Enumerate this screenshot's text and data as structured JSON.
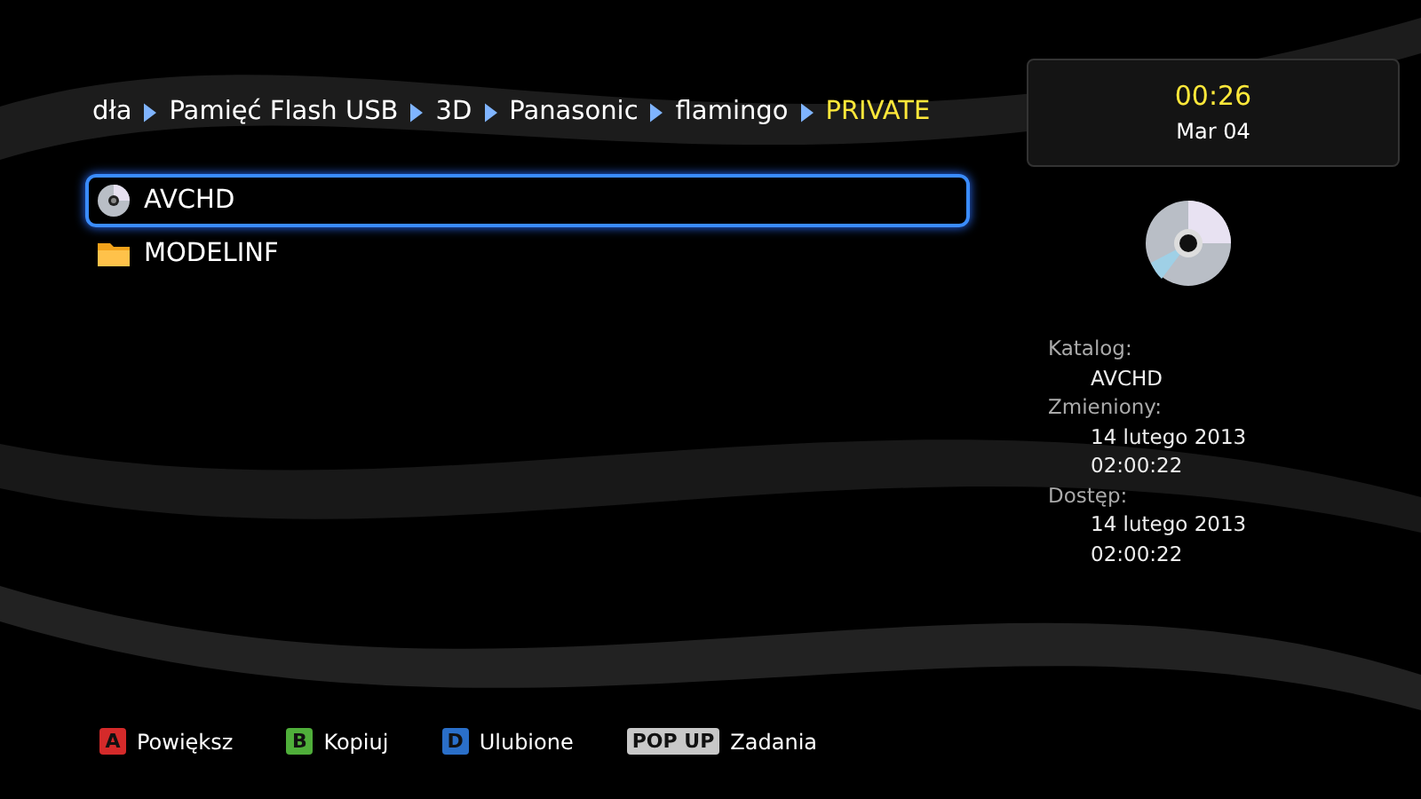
{
  "breadcrumb": [
    {
      "label": "dła",
      "current": false
    },
    {
      "label": "Pamięć Flash USB",
      "current": false
    },
    {
      "label": "3D",
      "current": false
    },
    {
      "label": "Panasonic",
      "current": false
    },
    {
      "label": "flamingo",
      "current": false
    },
    {
      "label": "PRIVATE",
      "current": true
    }
  ],
  "clock": {
    "time": "00:26",
    "date": "Mar 04"
  },
  "items": [
    {
      "label": "AVCHD",
      "kind": "disc",
      "selected": true
    },
    {
      "label": "MODELINF",
      "kind": "folder",
      "selected": false
    }
  ],
  "details": [
    {
      "label": "Katalog:",
      "values": [
        "AVCHD"
      ]
    },
    {
      "label": "Zmieniony:",
      "values": [
        "14 lutego 2013",
        "02:00:22"
      ]
    },
    {
      "label": "Dostęp:",
      "values": [
        "14 lutego 2013",
        "02:00:22"
      ]
    }
  ],
  "footer": [
    {
      "key": "A",
      "color": "#d42a2a",
      "label": "Powiększ"
    },
    {
      "key": "B",
      "color": "#4fae3a",
      "label": "Kopiuj"
    },
    {
      "key": "D",
      "color": "#2a6fc9",
      "label": "Ulubione"
    },
    {
      "key": "POP UP",
      "color": "#c8c8c8",
      "label": "Zadania"
    }
  ]
}
